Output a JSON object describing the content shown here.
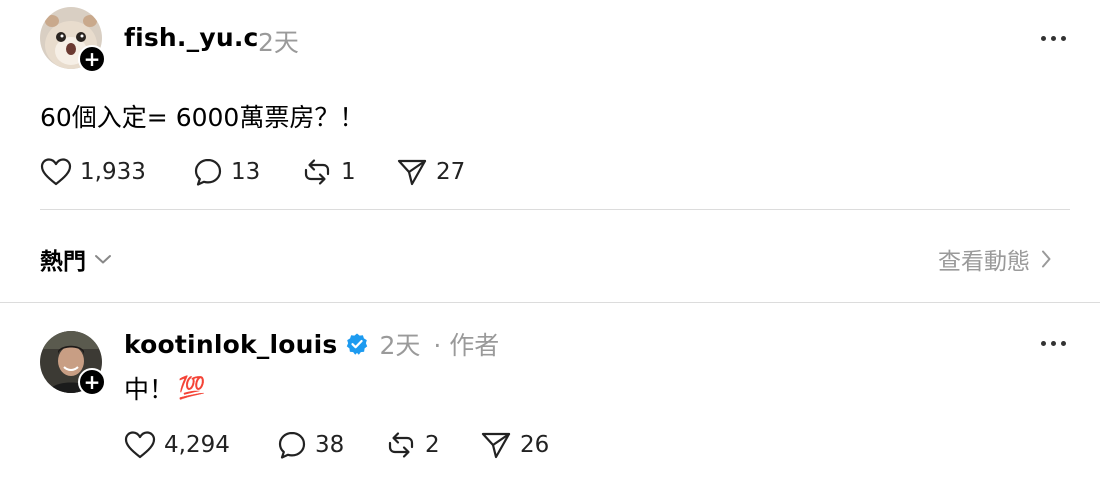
{
  "post": {
    "username": "fish._yu.c",
    "time": "2天",
    "text": "60個入定= 6000萬票房？！",
    "likes": "1,933",
    "comments": "13",
    "reposts": "1",
    "shares": "27"
  },
  "sort": {
    "label": "熱門",
    "view_activity": "查看動態"
  },
  "reply": {
    "username": "kootinlok_louis",
    "time": "2天",
    "role": "· 作者",
    "text": "中！",
    "emoji": "💯",
    "likes": "4,294",
    "comments": "38",
    "reposts": "2",
    "shares": "26"
  },
  "colors": {
    "verified": "#1d9bf0",
    "muted": "#9a9a9a",
    "divider": "#dcdcdc"
  },
  "icons": {
    "like": "heart-icon",
    "comment": "comment-bubble-icon",
    "repost": "repost-icon",
    "share": "share-paper-plane-icon",
    "verified": "verified-badge-icon",
    "more": "more-dots-icon",
    "follow": "plus-icon"
  }
}
